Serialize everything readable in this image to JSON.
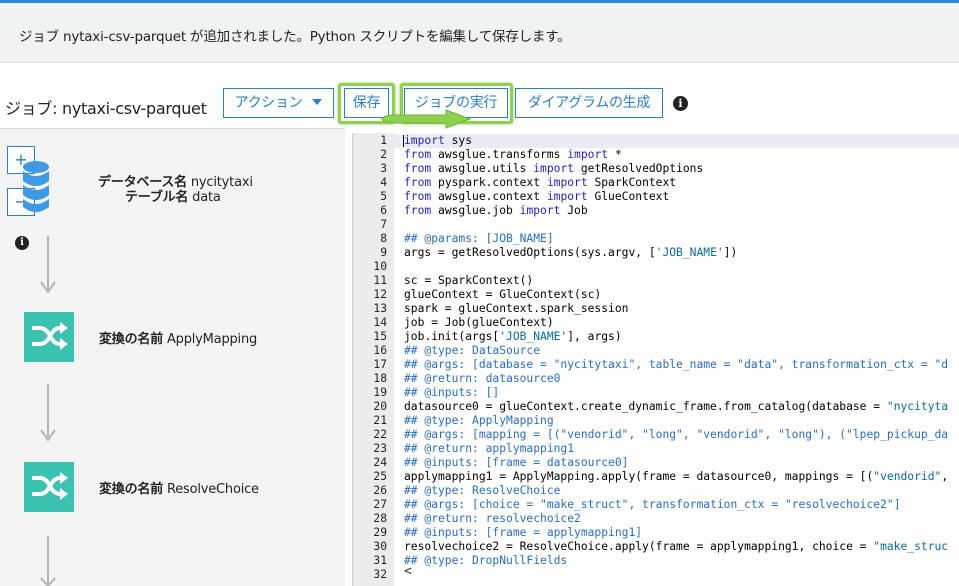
{
  "banner": {
    "message": "ジョブ nytaxi-csv-parquet が追加されました。Python スクリプトを編集して保存します。"
  },
  "header": {
    "job_title": "ジョブ: nytaxi-csv-parquet",
    "buttons": {
      "action": "アクション",
      "save": "保存",
      "run": "ジョブの実行",
      "diagram": "ダイアグラムの生成"
    },
    "highlight_color": "#8fd14f"
  },
  "diagram": {
    "zoom_in": "+",
    "zoom_out": "−",
    "source": {
      "db_key": "データベース名",
      "db_value": "nycitytaxi",
      "table_key": "テーブル名",
      "table_value": "data"
    },
    "transforms": [
      {
        "key": "変換の名前",
        "value": "ApplyMapping"
      },
      {
        "key": "変換の名前",
        "value": "ResolveChoice"
      }
    ]
  },
  "editor": {
    "scroll_left": "<",
    "lines": [
      {
        "n": "1",
        "tokens": [
          [
            "k",
            "import"
          ],
          [
            "t",
            " sys"
          ]
        ]
      },
      {
        "n": "2",
        "tokens": [
          [
            "k",
            "from"
          ],
          [
            "t",
            " awsglue.transforms "
          ],
          [
            "k",
            "import"
          ],
          [
            "t",
            " *"
          ]
        ]
      },
      {
        "n": "3",
        "tokens": [
          [
            "k",
            "from"
          ],
          [
            "t",
            " awsglue.utils "
          ],
          [
            "k",
            "import"
          ],
          [
            "t",
            " getResolvedOptions"
          ]
        ]
      },
      {
        "n": "4",
        "tokens": [
          [
            "k",
            "from"
          ],
          [
            "t",
            " pyspark.context "
          ],
          [
            "k",
            "import"
          ],
          [
            "t",
            " SparkContext"
          ]
        ]
      },
      {
        "n": "5",
        "tokens": [
          [
            "k",
            "from"
          ],
          [
            "t",
            " awsglue.context "
          ],
          [
            "k",
            "import"
          ],
          [
            "t",
            " GlueContext"
          ]
        ]
      },
      {
        "n": "6",
        "tokens": [
          [
            "k",
            "from"
          ],
          [
            "t",
            " awsglue.job "
          ],
          [
            "k",
            "import"
          ],
          [
            "t",
            " Job"
          ]
        ]
      },
      {
        "n": "7",
        "tokens": []
      },
      {
        "n": "8",
        "tokens": [
          [
            "c",
            "## @params: [JOB_NAME]"
          ]
        ]
      },
      {
        "n": "9",
        "tokens": [
          [
            "t",
            "args = getResolvedOptions(sys.argv, ["
          ],
          [
            "s",
            "'JOB_NAME'"
          ],
          [
            "t",
            "])"
          ]
        ]
      },
      {
        "n": "10",
        "tokens": []
      },
      {
        "n": "11",
        "tokens": [
          [
            "t",
            "sc = SparkContext()"
          ]
        ]
      },
      {
        "n": "12",
        "tokens": [
          [
            "t",
            "glueContext = GlueContext(sc)"
          ]
        ]
      },
      {
        "n": "13",
        "tokens": [
          [
            "t",
            "spark = glueContext.spark_session"
          ]
        ]
      },
      {
        "n": "14",
        "tokens": [
          [
            "t",
            "job = Job(glueContext)"
          ]
        ]
      },
      {
        "n": "15",
        "tokens": [
          [
            "t",
            "job.init(args["
          ],
          [
            "s",
            "'JOB_NAME'"
          ],
          [
            "t",
            "], args)"
          ]
        ]
      },
      {
        "n": "16",
        "tokens": [
          [
            "c",
            "## @type: DataSource"
          ]
        ]
      },
      {
        "n": "17",
        "tokens": [
          [
            "c",
            "## @args: [database = \"nycitytaxi\", table_name = \"data\", transformation_ctx = \"d"
          ]
        ]
      },
      {
        "n": "18",
        "tokens": [
          [
            "c",
            "## @return: datasource0"
          ]
        ]
      },
      {
        "n": "19",
        "tokens": [
          [
            "c",
            "## @inputs: []"
          ]
        ]
      },
      {
        "n": "20",
        "tokens": [
          [
            "t",
            "datasource0 = glueContext.create_dynamic_frame.from_catalog(database = "
          ],
          [
            "s",
            "\"nycityta"
          ]
        ]
      },
      {
        "n": "21",
        "tokens": [
          [
            "c",
            "## @type: ApplyMapping"
          ]
        ]
      },
      {
        "n": "22",
        "tokens": [
          [
            "c",
            "## @args: [mapping = [(\"vendorid\", \"long\", \"vendorid\", \"long\"), (\"lpep_pickup_da"
          ]
        ]
      },
      {
        "n": "23",
        "tokens": [
          [
            "c",
            "## @return: applymapping1"
          ]
        ]
      },
      {
        "n": "24",
        "tokens": [
          [
            "c",
            "## @inputs: [frame = datasource0]"
          ]
        ]
      },
      {
        "n": "25",
        "tokens": [
          [
            "t",
            "applymapping1 = ApplyMapping.apply(frame = datasource0, mappings = [("
          ],
          [
            "s",
            "\"vendorid\""
          ],
          [
            "t",
            ","
          ]
        ]
      },
      {
        "n": "26",
        "tokens": [
          [
            "c",
            "## @type: ResolveChoice"
          ]
        ]
      },
      {
        "n": "27",
        "tokens": [
          [
            "c",
            "## @args: [choice = \"make_struct\", transformation_ctx = \"resolvechoice2\"]"
          ]
        ]
      },
      {
        "n": "28",
        "tokens": [
          [
            "c",
            "## @return: resolvechoice2"
          ]
        ]
      },
      {
        "n": "29",
        "tokens": [
          [
            "c",
            "## @inputs: [frame = applymapping1]"
          ]
        ]
      },
      {
        "n": "30",
        "tokens": [
          [
            "t",
            "resolvechoice2 = ResolveChoice.apply(frame = applymapping1, choice = "
          ],
          [
            "s",
            "\"make_struc"
          ]
        ]
      },
      {
        "n": "31",
        "tokens": [
          [
            "c",
            "## @type: DropNullFields"
          ]
        ]
      },
      {
        "n": "32",
        "tokens": []
      }
    ]
  }
}
